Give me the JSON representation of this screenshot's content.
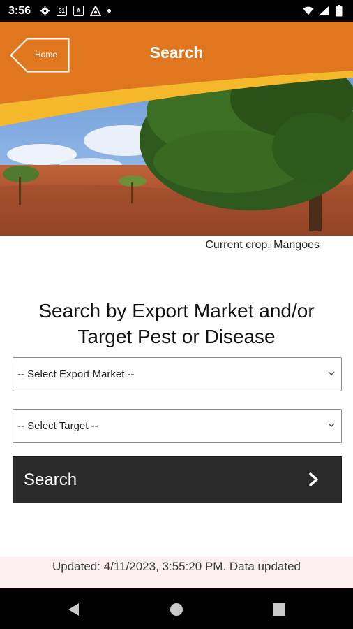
{
  "status_bar": {
    "time": "3:56",
    "icons": [
      "gear-icon",
      "calendar-icon",
      "a-box-icon",
      "triangle-logo-icon",
      "dot-icon"
    ],
    "calendar_text": "31",
    "a_text": "A",
    "right_icons": [
      "wifi-icon",
      "signal-icon",
      "battery-icon"
    ]
  },
  "header": {
    "home_label": "Home",
    "title": "Search",
    "accent_color": "#e0771e"
  },
  "crop": {
    "text": "Current crop: Mangoes"
  },
  "search_form": {
    "heading_line1": "Search by Export Market and/or",
    "heading_line2": "Target Pest or Disease",
    "market_select": {
      "selected": "-- Select Export Market --"
    },
    "target_select": {
      "selected": "-- Select Target --"
    },
    "search_label": "Search"
  },
  "footer": {
    "update_text": "Updated: 4/11/2023, 3:55:20 PM. Data updated"
  },
  "nav": {
    "buttons": [
      "back-icon",
      "home-circle-icon",
      "recents-square-icon"
    ]
  }
}
